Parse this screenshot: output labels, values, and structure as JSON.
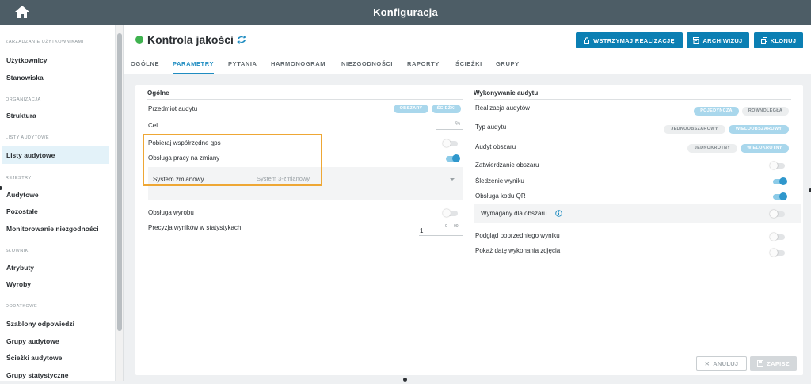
{
  "app": {
    "title": "Konfiguracja"
  },
  "sidebar": {
    "groups": [
      {
        "title": "ZARZĄDZANIE UŻYTKOWNIKAMI",
        "items": [
          {
            "label": "Użytkownicy"
          },
          {
            "label": "Stanowiska"
          }
        ]
      },
      {
        "title": "ORGANIZACJA",
        "items": [
          {
            "label": "Struktura"
          }
        ]
      },
      {
        "title": "LISTY AUDYTOWE",
        "items": [
          {
            "label": "Listy audytowe",
            "active": true
          }
        ]
      },
      {
        "title": "REJESTRY",
        "items": [
          {
            "label": "Audytowe"
          },
          {
            "label": "Pozostałe"
          },
          {
            "label": "Monitorowanie niezgodności"
          }
        ]
      },
      {
        "title": "SŁOWNIKI",
        "items": [
          {
            "label": "Atrybuty"
          },
          {
            "label": "Wyroby"
          }
        ]
      },
      {
        "title": "DODATKOWE",
        "items": [
          {
            "label": "Szablony odpowiedzi"
          },
          {
            "label": "Grupy audytowe"
          },
          {
            "label": "Ścieżki audytowe"
          },
          {
            "label": "Grupy statystyczne"
          }
        ]
      }
    ]
  },
  "header": {
    "title": "Kontrola jakości",
    "status_color": "#3fb24f",
    "buttons": {
      "suspend": "WSTRZYMAJ REALIZACJĘ",
      "archive": "ARCHIWIZUJ",
      "clone": "KLONUJ"
    },
    "tabs": [
      {
        "label": "OGÓLNE"
      },
      {
        "label": "PARAMETRY",
        "active": true
      },
      {
        "label": "PYTANIA"
      },
      {
        "label": "HARMONOGRAM"
      },
      {
        "label": "NIEZGODNOŚCI"
      },
      {
        "label": "RAPORTY"
      },
      {
        "label": "ŚCIEŻKI"
      },
      {
        "label": "GRUPY"
      }
    ]
  },
  "general": {
    "title": "Ogólne",
    "subject": {
      "label": "Przedmiot audytu",
      "options": [
        "OBSZARY",
        "ŚCIEŻKI"
      ]
    },
    "goal": {
      "label": "Cel",
      "unit": "%",
      "value": ""
    },
    "gps": {
      "label": "Pobieraj współrzędne gps",
      "on": false
    },
    "shift": {
      "label": "Obsługa pracy na zmiany",
      "on": true
    },
    "shift_system": {
      "label": "System zmianowy",
      "value": "System 3-zmianowy"
    },
    "product": {
      "label": "Obsługa wyrobu",
      "on": false
    },
    "precision": {
      "label": "Precyzja wyników w statystykach",
      "value": "1",
      "stepper_up": "0",
      "stepper_down": "00"
    }
  },
  "execution": {
    "title": "Wykonywanie audytu",
    "realization": {
      "label": "Realizacja audytów",
      "options": [
        "POJEDYNCZA",
        "RÓWNOLEGŁA"
      ],
      "selected": 0
    },
    "type": {
      "label": "Typ audytu",
      "options": [
        "JEDNOOBSZAROWY",
        "WIELOOBSZAROWY"
      ],
      "selected": 1
    },
    "area_audit": {
      "label": "Audyt obszaru",
      "options": [
        "JEDNOKROTNY",
        "WIELOKROTNY"
      ],
      "selected": 1
    },
    "approval": {
      "label": "Zatwierdzanie obszaru",
      "on": false
    },
    "tracking": {
      "label": "Śledzenie wyniku",
      "on": true
    },
    "qr": {
      "label": "Obsługa kodu QR",
      "on": true
    },
    "qr_required": {
      "label": "Wymagany dla obszaru",
      "on": false
    },
    "preview": {
      "label": "Podgląd poprzedniego wyniku",
      "on": false
    },
    "photo_date": {
      "label": "Pokaż datę wykonania zdjęcia",
      "on": false
    }
  },
  "footer": {
    "cancel": "ANULUJ",
    "save": "ZAPISZ"
  },
  "colors": {
    "accent": "#0b7fb3",
    "highlight": "#eea735",
    "topbar": "#4d5d66"
  }
}
